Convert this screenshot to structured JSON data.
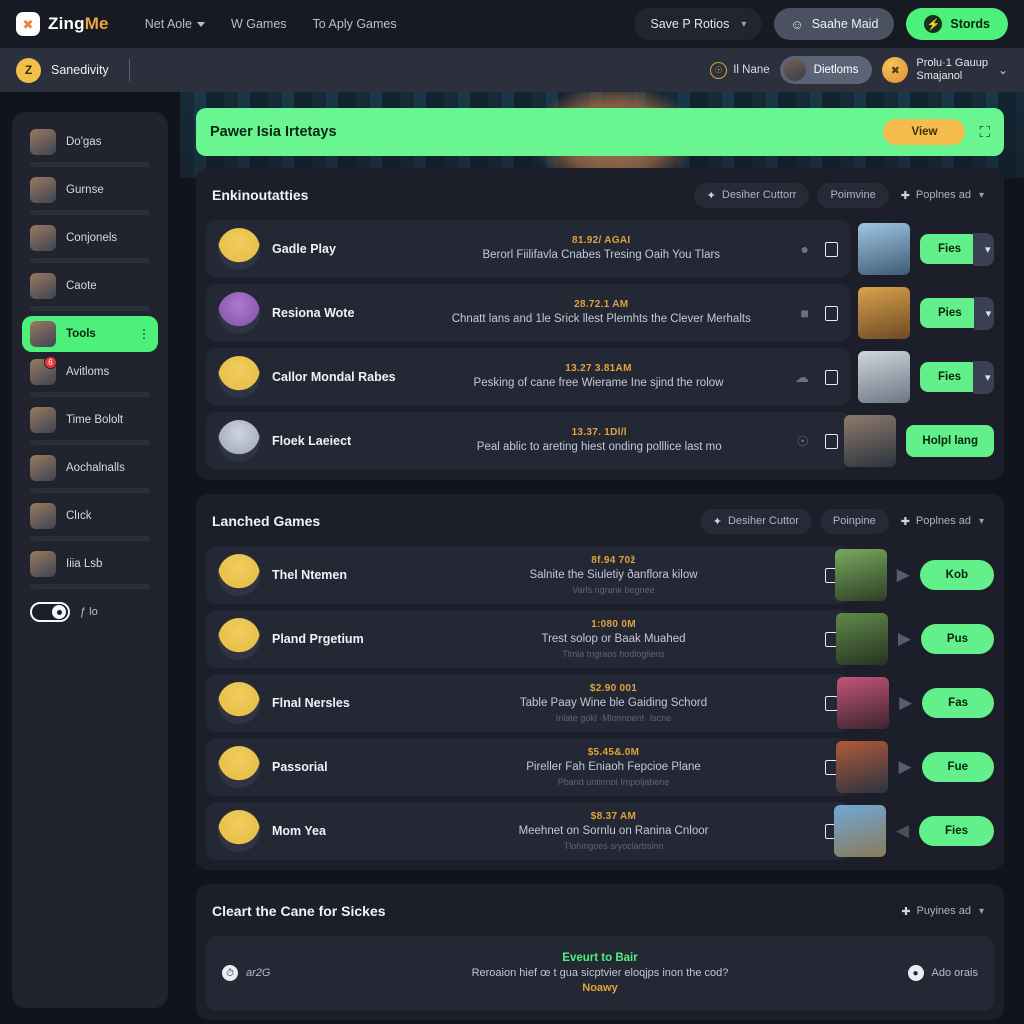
{
  "brand": {
    "name_part1": "Zing",
    "name_part2": "Me",
    "logo_icon": "zingme-logo-icon"
  },
  "topnav": {
    "links": [
      {
        "label": "Net Aole",
        "has_caret": true
      },
      {
        "label": "W Games",
        "has_caret": false
      },
      {
        "label": "To Aply Games",
        "has_caret": false
      }
    ],
    "save_profile": {
      "label": "Save P Rotios",
      "caret": "▾"
    },
    "account": {
      "label": "Saahe Maid",
      "icon": "person-icon"
    },
    "stores": {
      "label": "Stords",
      "icon": "bolt-icon"
    }
  },
  "subbar": {
    "avatar_initial": "Z",
    "user_name": "Sanedivity",
    "notif": {
      "label": "Il Nane",
      "icon": "bell-ring-icon"
    },
    "active_chip": {
      "label": "Dietloms"
    },
    "group": {
      "line1": "Prolu·1 Gauup",
      "line2": "Smajanol",
      "caret": "⌄"
    }
  },
  "sidebar": {
    "items": [
      {
        "label": "Do'gas",
        "active": false,
        "badge": null
      },
      {
        "label": "Gurnse",
        "active": false,
        "badge": null
      },
      {
        "label": "Conjonels",
        "active": false,
        "badge": null
      },
      {
        "label": "Caote",
        "active": false,
        "badge": null
      },
      {
        "label": "Tools",
        "active": true,
        "badge": null,
        "menu": "⋮"
      },
      {
        "label": "Avitloms",
        "active": false,
        "badge": "6"
      },
      {
        "label": "Time Bololt",
        "active": false,
        "badge": null
      },
      {
        "label": "Aochalnalls",
        "active": false,
        "badge": null
      },
      {
        "label": "Clıck",
        "active": false,
        "badge": null
      },
      {
        "label": "Iiia Lsb",
        "active": false,
        "badge": null
      }
    ],
    "toggle": {
      "label": "ƒ lo",
      "on": true
    }
  },
  "banner": {
    "title": "Pawer Isia Irtetays",
    "view_label": "View",
    "external_icon": "external-link-icon"
  },
  "sections": [
    {
      "title": "Enkinoutatties",
      "actions": [
        {
          "label": "Desiher Cuttorr",
          "icon": "sparkle-icon",
          "style": "chip"
        },
        {
          "label": "Poimvine",
          "icon": null,
          "style": "chip"
        },
        {
          "label": "Poplnes ad",
          "icon": "plus-icon",
          "style": "bare"
        }
      ],
      "rows": [
        {
          "name": "Gadle Play",
          "time": "81.92/ AGAI",
          "desc": "Berorl Fiilifavla Cnabes Tresing Oaih You Tlars",
          "sub": null,
          "icons": [
            "user-badge-icon",
            "phone-icon"
          ],
          "thumb": "t1",
          "avatar": "a1",
          "action": {
            "label": "Fies",
            "type": "split",
            "caret": "⌄"
          }
        },
        {
          "name": "Resiona Wote",
          "time": "28.72.1 AM",
          "desc": "Chnatt lans and 1le Srick llest Plemhts the Clever Merhalts",
          "sub": null,
          "icons": [
            "thumb-icon",
            "phone-icon"
          ],
          "thumb": "t2",
          "avatar": "a2",
          "action": {
            "label": "Pies",
            "type": "split",
            "caret": "⌄"
          }
        },
        {
          "name": "Callor Mondal Rabes",
          "time": "13.27 3.81AM",
          "desc": "Pesking of cane free Wierame Ine sjind the rolow",
          "sub": null,
          "icons": [
            "cloud-icon",
            "phone-icon"
          ],
          "thumb": "t3",
          "avatar": "a1",
          "action": {
            "label": "Fies",
            "type": "split",
            "caret": "⌄"
          }
        },
        {
          "name": "Floek Laeiect",
          "time": "13.37. 1Dl/l",
          "desc": "Peal ablic to areting hiest onding polllice last mo",
          "sub": null,
          "icons": [
            "mic-icon",
            "phone-icon"
          ],
          "thumb": "t4",
          "avatar": "a4",
          "action": {
            "label": "Holpl lang",
            "type": "single"
          }
        }
      ]
    },
    {
      "title": "Lanched Games",
      "actions": [
        {
          "label": "Desiher Cuttor",
          "icon": "sparkle-icon",
          "style": "chip"
        },
        {
          "label": "Poinpine",
          "icon": null,
          "style": "chip"
        },
        {
          "label": "Poplnes ad",
          "icon": "plus-icon",
          "style": "bare"
        }
      ],
      "rows": [
        {
          "name": "Thel Ntemen",
          "time": "8f.94 70ž",
          "desc": "Salnite the Siuletiy ðanflora kilow",
          "sub": "Varls ngrank begnee",
          "icons": [
            "phone-icon"
          ],
          "thumb": "t5",
          "avatar": "a1",
          "arrow": "right",
          "action": {
            "label": "Kob",
            "type": "round"
          }
        },
        {
          "name": "Pland Prgetium",
          "time": "1:080 0M",
          "desc": "Trest solop or Baak Muahed",
          "sub": "Tlmla tngraos hodlogliens",
          "icons": [
            "phone-icon"
          ],
          "thumb": "t6",
          "avatar": "a1",
          "arrow": "right",
          "action": {
            "label": "Pus",
            "type": "round"
          }
        },
        {
          "name": "Flnal Nersles",
          "time": "$2.90 001",
          "desc": "Table Paay Wine ble Gaiding Schord",
          "sub": "Inlate gokl ·Mlonnoent· Iscne",
          "icons": [
            "phone-icon"
          ],
          "thumb": "t7",
          "avatar": "a1",
          "arrow": "right",
          "action": {
            "label": "Fas",
            "type": "round"
          }
        },
        {
          "name": "Passorial",
          "time": "$5.45&.0M",
          "desc": "Pireller Fah Eniaoh Fepcioe Plane",
          "sub": "Pband untinnol Impoljabene",
          "icons": [
            "phone-icon"
          ],
          "thumb": "t8",
          "avatar": "a1",
          "arrow": "right",
          "action": {
            "label": "Fue",
            "type": "round"
          }
        },
        {
          "name": "Mom Yea",
          "time": "$8.37 AM",
          "desc": "Meehnet on Sornlu on Ranina Cnloor",
          "sub": "Tlohingoes sryoclarbsinn",
          "icons": [
            "phone-icon"
          ],
          "thumb": "t9",
          "avatar": "a1",
          "arrow": "left",
          "action": {
            "label": "Fies",
            "type": "round"
          }
        }
      ]
    }
  ],
  "bottom_section": {
    "title": "Cleart the Cane for Sickes",
    "action": {
      "label": "Puyines ad",
      "icon": "plus-icon"
    },
    "event": {
      "left_label": "ar2G",
      "left_icon": "clock-icon",
      "title": "Eveurt to Bair",
      "desc": "Reroaion hief œ t gua sicptvier eloqjps inon the cod?",
      "note": "Noawy",
      "right_label": "Ado orais",
      "right_icon": "droplet-icon"
    }
  },
  "colors": {
    "accent_green": "#4df07a",
    "banner_green": "#69f58f",
    "amber": "#e0a33c",
    "view_yellow": "#f5bd4e",
    "page_bg": "#12141c",
    "card_bg": "#1c1f29",
    "row_bg": "#242835"
  }
}
